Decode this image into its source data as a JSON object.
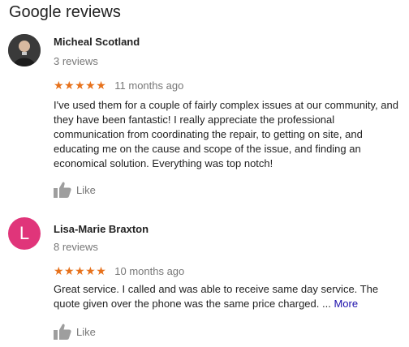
{
  "header": {
    "title": "Google reviews"
  },
  "reviews": [
    {
      "author": "Micheal Scotland",
      "reviews_count": "3 reviews",
      "stars": "★★★★★",
      "time_ago": "11 months ago",
      "text": "I've used them for a couple of fairly complex issues at our community, and they have been fantastic!  I really appreciate the professional communication from coordinating the repair, to getting on site, and educating me on the cause and scope of the issue, and finding an economical solution.  Everything was top notch!",
      "like_label": "Like"
    },
    {
      "author": "Lisa-Marie Braxton",
      "avatar_letter": "L",
      "reviews_count": "8 reviews",
      "stars": "★★★★★",
      "time_ago": "10 months ago",
      "text": "Great service. I called and was able to receive same day service. The quote given over the phone was the same price charged. ...",
      "more_label": "More",
      "like_label": "Like"
    }
  ],
  "colors": {
    "star": "#e7711b",
    "avatar_l": "#e0357a",
    "link": "#1a0dab"
  }
}
